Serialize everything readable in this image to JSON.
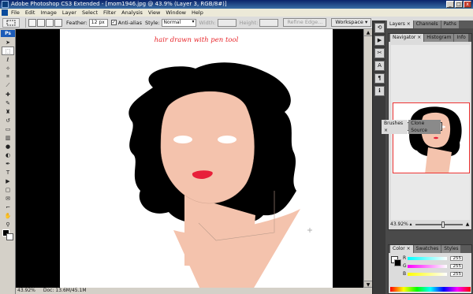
{
  "titlebar": {
    "title": "Adobe Photoshop CS3 Extended - [mom1946.jpg @ 43.9% (Layer 3, RGB/8#)]",
    "min": "_",
    "max": "□",
    "close": "x"
  },
  "menu": [
    "File",
    "Edit",
    "Image",
    "Layer",
    "Select",
    "Filter",
    "Analysis",
    "View",
    "Window",
    "Help"
  ],
  "options": {
    "feather_label": "Feather:",
    "feather_value": "12 px",
    "antialias_label": "Anti-alias",
    "antialias_checked": "✓",
    "style_label": "Style:",
    "style_value": "Normal",
    "width_label": "Width:",
    "height_label": "Height:",
    "refine_edge": "Refine Edge...",
    "workspace": "Workspace ▾"
  },
  "toolbox": {
    "logo": "Ps",
    "tools": [
      {
        "name": "move-tool",
        "glyph": "➤"
      },
      {
        "name": "marquee-tool",
        "glyph": "⬚"
      },
      {
        "name": "lasso-tool",
        "glyph": "ℓ"
      },
      {
        "name": "quick-selection-tool",
        "glyph": "✧"
      },
      {
        "name": "crop-tool",
        "glyph": "⌗"
      },
      {
        "name": "slice-tool",
        "glyph": "⟋"
      },
      {
        "name": "healing-brush-tool",
        "glyph": "✚"
      },
      {
        "name": "brush-tool",
        "glyph": "✎"
      },
      {
        "name": "clone-stamp-tool",
        "glyph": "♜"
      },
      {
        "name": "history-brush-tool",
        "glyph": "↺"
      },
      {
        "name": "eraser-tool",
        "glyph": "▭"
      },
      {
        "name": "gradient-tool",
        "glyph": "▥"
      },
      {
        "name": "blur-tool",
        "glyph": "●"
      },
      {
        "name": "dodge-tool",
        "glyph": "◐"
      },
      {
        "name": "pen-tool",
        "glyph": "✒"
      },
      {
        "name": "type-tool",
        "glyph": "T"
      },
      {
        "name": "path-selection-tool",
        "glyph": "▶"
      },
      {
        "name": "shape-tool",
        "glyph": "▢"
      },
      {
        "name": "notes-tool",
        "glyph": "✉"
      },
      {
        "name": "eyedropper-tool",
        "glyph": "⌐"
      },
      {
        "name": "hand-tool",
        "glyph": "✋"
      },
      {
        "name": "zoom-tool",
        "glyph": "⚲"
      }
    ]
  },
  "canvas": {
    "caption": "hair drawn with pen tool",
    "hair_color": "#000000",
    "skin_color": "#f4c3ad",
    "lip_color": "#e8203a",
    "caption_color": "#e8262b"
  },
  "status": {
    "zoom": "43.92%",
    "doc": "Doc: 13.6M/45.1M"
  },
  "panels": {
    "top_tabs": [
      "Layers ×",
      "Channels",
      "Paths"
    ],
    "nav_tabs": [
      "Navigator ×",
      "Histogram",
      "Info"
    ],
    "nav_zoom": "43.92%",
    "float_tabs": [
      "Brushes ×",
      "Clone Source"
    ],
    "color_tabs": [
      "Color ×",
      "Swatches",
      "Styles"
    ],
    "color_rows": [
      {
        "label": "R",
        "value": "255"
      },
      {
        "label": "G",
        "value": "255"
      },
      {
        "label": "B",
        "value": "255"
      }
    ]
  },
  "dock_icons": [
    "history-icon",
    "actions-icon",
    "tool-presets-icon",
    "character-icon",
    "paragraph-icon",
    "info-icon"
  ]
}
